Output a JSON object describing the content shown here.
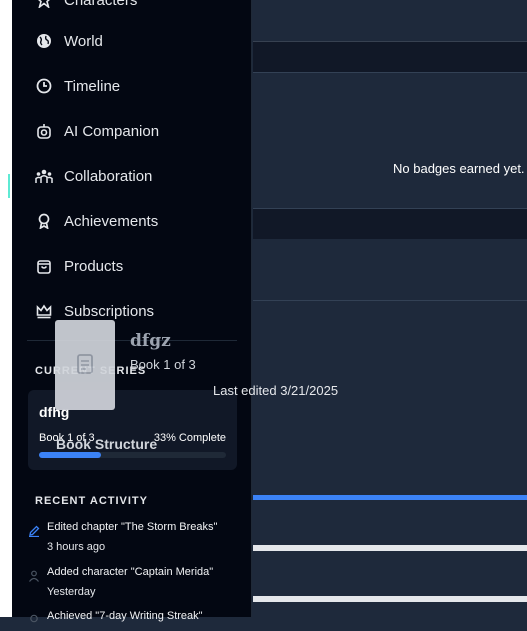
{
  "nav": {
    "items": [
      {
        "label": "Characters",
        "icon": "star-icon"
      },
      {
        "label": "World",
        "icon": "globe-icon"
      },
      {
        "label": "Timeline",
        "icon": "clock-icon"
      },
      {
        "label": "AI Companion",
        "icon": "robot-icon"
      },
      {
        "label": "Collaboration",
        "icon": "users-icon"
      },
      {
        "label": "Achievements",
        "icon": "award-icon"
      },
      {
        "label": "Products",
        "icon": "shopping-bag-icon"
      },
      {
        "label": "Subscriptions",
        "icon": "crown-icon"
      }
    ]
  },
  "current_series": {
    "heading": "CURRENT SERIES",
    "name": "dfhg",
    "book": "Book 1 of 3",
    "complete": "33% Complete",
    "progress_fraction": 0.33,
    "accent": "#3b82f6"
  },
  "recent_activity": {
    "heading": "RECENT ACTIVITY",
    "items": [
      {
        "text": "Edited chapter \"The Storm Breaks\"",
        "time": "3 hours ago",
        "icon": "pencil-icon"
      },
      {
        "text": "Added character \"Captain Merida\"",
        "time": "Yesterday",
        "icon": "user-icon"
      },
      {
        "text": "Achieved \"7-day Writing Streak\"",
        "time": "",
        "icon": "award-icon"
      }
    ]
  },
  "main": {
    "badges_empty": "No badges earned yet."
  },
  "drag_preview": {
    "title": "dfgz",
    "subtitle": "Book 1 of 3",
    "edited": "Last edited 3/21/2025",
    "section": "Book Structure",
    "icon": "document-icon"
  }
}
